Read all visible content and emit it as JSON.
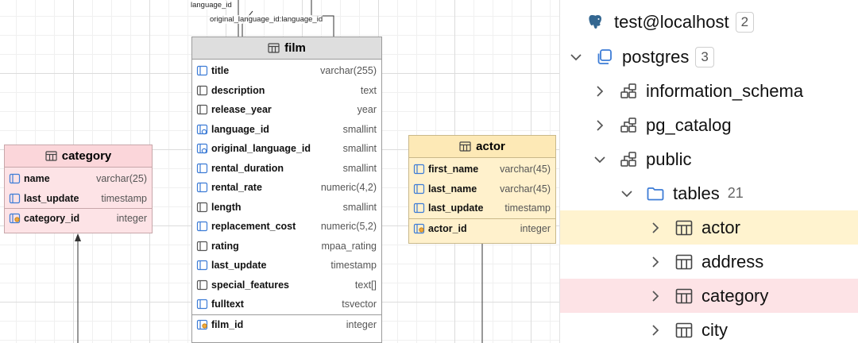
{
  "diagram": {
    "fk_labels": [
      "language_id",
      "original_language_id:language_id"
    ],
    "film": {
      "name": "film",
      "columns": [
        {
          "name": "title",
          "type": "varchar(255)",
          "icon": "column-required-icon"
        },
        {
          "name": "description",
          "type": "text",
          "icon": "column-icon"
        },
        {
          "name": "release_year",
          "type": "year",
          "icon": "column-icon"
        },
        {
          "name": "language_id",
          "type": "smallint",
          "icon": "foreign-key-icon"
        },
        {
          "name": "original_language_id",
          "type": "smallint",
          "icon": "foreign-key-icon"
        },
        {
          "name": "rental_duration",
          "type": "smallint",
          "icon": "column-required-icon"
        },
        {
          "name": "rental_rate",
          "type": "numeric(4,2)",
          "icon": "column-required-icon"
        },
        {
          "name": "length",
          "type": "smallint",
          "icon": "column-icon"
        },
        {
          "name": "replacement_cost",
          "type": "numeric(5,2)",
          "icon": "column-required-icon"
        },
        {
          "name": "rating",
          "type": "mpaa_rating",
          "icon": "column-icon"
        },
        {
          "name": "last_update",
          "type": "timestamp",
          "icon": "column-required-icon"
        },
        {
          "name": "special_features",
          "type": "text[]",
          "icon": "column-icon"
        },
        {
          "name": "fulltext",
          "type": "tsvector",
          "icon": "column-required-icon"
        }
      ],
      "pk": {
        "name": "film_id",
        "type": "integer",
        "icon": "primary-key-icon"
      }
    },
    "category": {
      "name": "category",
      "columns": [
        {
          "name": "name",
          "type": "varchar(25)",
          "icon": "column-required-icon"
        },
        {
          "name": "last_update",
          "type": "timestamp",
          "icon": "column-required-icon"
        }
      ],
      "pk": {
        "name": "category_id",
        "type": "integer",
        "icon": "primary-key-icon"
      }
    },
    "actor": {
      "name": "actor",
      "columns": [
        {
          "name": "first_name",
          "type": "varchar(45)",
          "icon": "column-required-icon"
        },
        {
          "name": "last_name",
          "type": "varchar(45)",
          "icon": "column-required-icon"
        },
        {
          "name": "last_update",
          "type": "timestamp",
          "icon": "column-required-icon"
        }
      ],
      "pk": {
        "name": "actor_id",
        "type": "integer",
        "icon": "primary-key-icon"
      }
    }
  },
  "tree": [
    {
      "label": "test@localhost",
      "badge": "2",
      "icon": "postgres-elephant-icon",
      "chevron": "none",
      "level": 0,
      "highlight": "none"
    },
    {
      "label": "postgres",
      "badge": "3",
      "icon": "database-icon",
      "chevron": "down",
      "level": 0,
      "highlight": "none"
    },
    {
      "label": "information_schema",
      "icon": "schema-icon",
      "chevron": "right",
      "level": 1,
      "highlight": "none"
    },
    {
      "label": "pg_catalog",
      "icon": "schema-icon",
      "chevron": "right",
      "level": 1,
      "highlight": "none"
    },
    {
      "label": "public",
      "icon": "schema-icon",
      "chevron": "down",
      "level": 1,
      "highlight": "none"
    },
    {
      "label": "tables",
      "count": "21",
      "icon": "folder-icon",
      "chevron": "down",
      "level": 2,
      "highlight": "none"
    },
    {
      "label": "actor",
      "icon": "table-icon",
      "chevron": "right",
      "level": 3,
      "highlight": "#fff3cf"
    },
    {
      "label": "address",
      "icon": "table-icon",
      "chevron": "right",
      "level": 3,
      "highlight": "none"
    },
    {
      "label": "category",
      "icon": "table-icon",
      "chevron": "right",
      "level": 3,
      "highlight": "#fde3e6"
    },
    {
      "label": "city",
      "icon": "table-icon",
      "chevron": "right",
      "level": 3,
      "highlight": "none"
    }
  ],
  "colors": {
    "accent": "#3d7cd6",
    "category_bg": "#fde3e6",
    "actor_bg": "#fff1cc",
    "film_header": "#dedede"
  }
}
